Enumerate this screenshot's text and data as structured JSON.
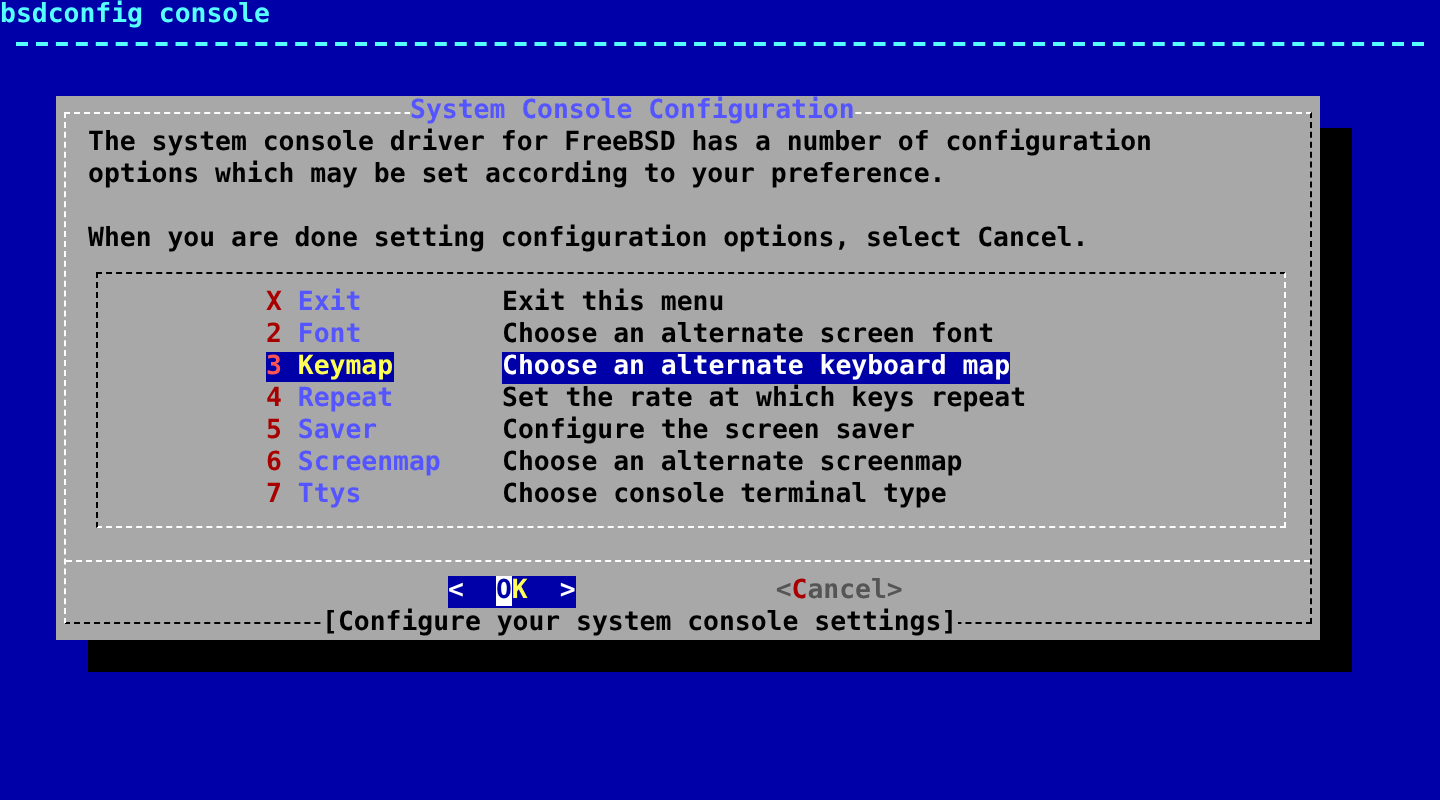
{
  "screen_title": "bsdconfig console",
  "dialog": {
    "title": "System Console Configuration",
    "prompt_paragraphs": [
      [
        "The system console driver for FreeBSD has a number of configuration",
        "options which may be set according to your preference."
      ],
      [
        "When you are done setting configuration options, select Cancel."
      ]
    ],
    "menu": [
      {
        "key": "X",
        "name": "Exit",
        "description": "Exit this menu",
        "selected": false
      },
      {
        "key": "2",
        "name": "Font",
        "description": "Choose an alternate screen font",
        "selected": false
      },
      {
        "key": "3",
        "name": "Keymap",
        "description": "Choose an alternate keyboard map",
        "selected": true
      },
      {
        "key": "4",
        "name": "Repeat",
        "description": "Set the rate at which keys repeat",
        "selected": false
      },
      {
        "key": "5",
        "name": "Saver",
        "description": "Configure the screen saver",
        "selected": false
      },
      {
        "key": "6",
        "name": "Screenmap",
        "description": "Choose an alternate screenmap",
        "selected": false
      },
      {
        "key": "7",
        "name": "Ttys",
        "description": "Choose console terminal type",
        "selected": false
      }
    ],
    "buttons": [
      {
        "open": "<",
        "label": "OK",
        "close": ">",
        "selected": true
      },
      {
        "open": "<",
        "label": "Cancel",
        "close": ">",
        "selected": false
      }
    ],
    "hint": "[Configure your system console settings]"
  }
}
